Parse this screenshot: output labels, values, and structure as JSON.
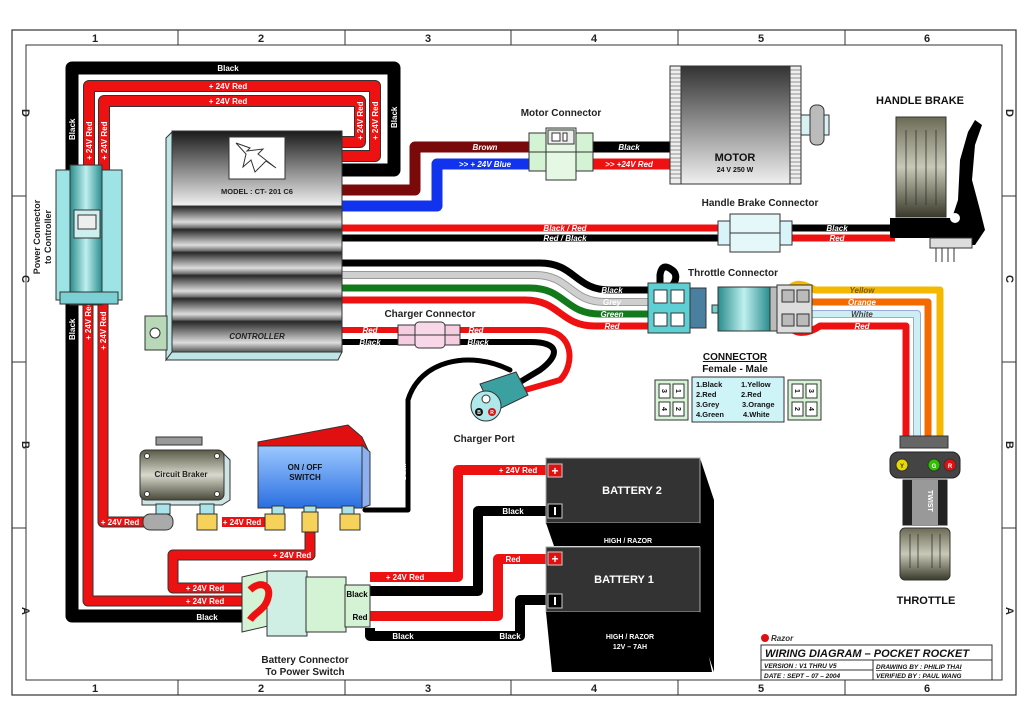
{
  "frame": {
    "columns": [
      "1",
      "2",
      "3",
      "4",
      "5",
      "6"
    ],
    "rows": [
      "D",
      "C",
      "B",
      "A"
    ]
  },
  "components": {
    "controller": {
      "model": "MODEL : CT- 201 C6",
      "label": "CONTROLLER"
    },
    "motor": {
      "label": "MOTOR",
      "spec": "24 V 250 W"
    },
    "motor_connector": {
      "label": "Motor Connector"
    },
    "handle_brake": {
      "label": "HANDLE BRAKE"
    },
    "handle_brake_connector": {
      "label": "Handle Brake Connector"
    },
    "throttle_connector": {
      "label": "Throttle Connector"
    },
    "throttle": {
      "label": "THROTTLE",
      "twist": "TWIST",
      "leds": [
        "Y",
        "G",
        "R"
      ]
    },
    "charger_connector": {
      "label": "Charger Connector"
    },
    "charger_port": {
      "label": "Charger Port",
      "pins": [
        "B",
        "R"
      ]
    },
    "power_connector": {
      "label_line1": "Power Connector",
      "label_line2": "to Controller"
    },
    "circuit_breaker": {
      "label": "Circuit Braker"
    },
    "switch": {
      "label_line1": "ON / OFF",
      "label_line2": "SWITCH"
    },
    "battery2": {
      "label": "BATTERY 2",
      "sub": "HIGH / RAZOR"
    },
    "battery1": {
      "label": "BATTERY 1",
      "sub": "HIGH / RAZOR",
      "spec": "12V – 7AH"
    },
    "battery_connector": {
      "label_line1": "Battery Connector",
      "label_line2": "To Power Switch"
    }
  },
  "connector_legend": {
    "title": "CONNECTOR",
    "subtitle": "Female  -  Male",
    "female": [
      "1.Black",
      "2.Red",
      "3.Grey",
      "4.Green"
    ],
    "male": [
      "1.Yellow",
      "2.Red",
      "3.Orange",
      "4.White"
    ],
    "female_pins": [
      "3",
      "1",
      "4",
      "2"
    ],
    "male_pins": [
      "1",
      "3",
      "2",
      "4"
    ]
  },
  "wires": {
    "black": "Black",
    "red24": "+ 24V Red",
    "brown": "Brown",
    "blue24": ">> + 24V Blue",
    "red24m": ">> +24V Red",
    "black_red": "Black / Red",
    "red_black": "Red / Black",
    "red": "Red",
    "grey": "Grey",
    "green": "Green",
    "yellow": "Yellow",
    "orange": "Orange",
    "white": "White"
  },
  "title_block": {
    "brand": "Razor",
    "title": "WIRING DIAGRAM – POCKET ROCKET",
    "version": "VERSION : V1 THRU V5",
    "date": "DATE : SEPT – 07 – 2004",
    "drawing_by": "DRAWING BY : PHILIP THAI",
    "verified_by": "VERIFIED BY : PAUL WANG"
  },
  "colors": {
    "red": "#ee1111",
    "black": "#000000",
    "brown": "#7a0a0a",
    "blue": "#1133ee",
    "green": "#127a1a",
    "grey": "#bbbbbb",
    "yellow": "#f5b800",
    "orange": "#f26a00",
    "white_wire": "#cdeef2",
    "connector_cyan": "#9ee3e6"
  }
}
